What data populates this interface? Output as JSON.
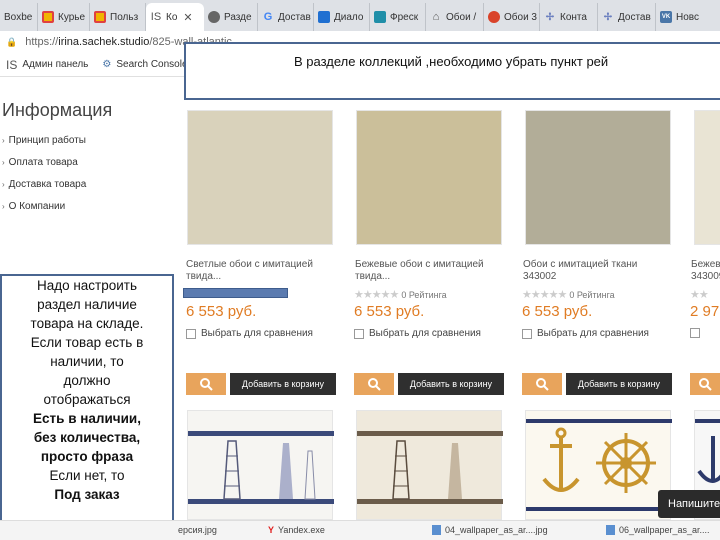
{
  "browser": {
    "tabs": [
      {
        "label": "Boxbe",
        "icon": "boxbe-icon",
        "color": "#ffffff",
        "text_color": "#444"
      },
      {
        "label": "Курье",
        "icon": "ms-icon",
        "color": "#e04040"
      },
      {
        "label": "Польз",
        "icon": "ms-icon",
        "color": "#e04040"
      },
      {
        "label": "Ко",
        "icon": "site-logo-icon",
        "color": "#ffffff",
        "active": true
      },
      {
        "label": "Разде",
        "icon": "wheel-icon",
        "color": "#666666"
      },
      {
        "label": "Достав",
        "icon": "google-icon",
        "color": "#4285f4"
      },
      {
        "label": "Диало",
        "icon": "chat-icon",
        "color": "#1f6fd1"
      },
      {
        "label": "Фреск",
        "icon": "fresco-icon",
        "color": "#1f8ea8"
      },
      {
        "label": "Обои /",
        "icon": "house-icon",
        "color": "#555555"
      },
      {
        "label": "Обои 3",
        "icon": "tomato-icon",
        "color": "#d9432a"
      },
      {
        "label": "Конта",
        "icon": "grid-icon",
        "color": "#6b7fbf"
      },
      {
        "label": "Достав",
        "icon": "grid-icon",
        "color": "#6b7fbf"
      },
      {
        "label": "Новс",
        "icon": "vk-icon",
        "color": "#4a76a8"
      }
    ],
    "url_prefix": "https://",
    "url_host": "irina.sachek.studio",
    "url_path": "/825-wall-atlantic",
    "bookmarks": {
      "admin": "Админ панель",
      "console": "Search Console"
    }
  },
  "sidebar": {
    "title": "Информация",
    "items": [
      "Принцип работы",
      "Оплата товара",
      "Доставка товара",
      "О Компании"
    ]
  },
  "products": [
    {
      "name_line1": "Светлые обои с имитацией",
      "name_line2": "твида...",
      "price": "6 553 руб.",
      "color": "#d9d2bb",
      "rating": null
    },
    {
      "name_line1": "Бежевые обои с имитацией",
      "name_line2": "твида...",
      "price": "6 553 руб.",
      "color": "#cbbf9a",
      "rating": "0 Рейтинга"
    },
    {
      "name_line1": "Обои с имитацией ткани",
      "name_line2": "343002",
      "price": "6 553 руб.",
      "color": "#b2ad98",
      "rating": "0 Рейтинга"
    },
    {
      "name_line1": "Бежевые",
      "name_line2": "343009",
      "price": "2 97",
      "color": "#e2dcc8",
      "rating": null
    }
  ],
  "product_common": {
    "compare_label": "Выбрать для сравнения",
    "cart_label": "Добавить в корзину"
  },
  "annotations": {
    "top": "В разделе коллекций ,необходимо убрать пункт рей",
    "left_lines": [
      {
        "text": "Надо настроить",
        "bold": false
      },
      {
        "text": "раздел наличие",
        "bold": false
      },
      {
        "text": "товара на складе.",
        "bold": false
      },
      {
        "text": "Если товар есть в",
        "bold": false
      },
      {
        "text": "наличии, то",
        "bold": false
      },
      {
        "text": "должно",
        "bold": false
      },
      {
        "text": "отображаться",
        "bold": false
      },
      {
        "text": "Есть в наличии,",
        "bold": true
      },
      {
        "text": "без количества,",
        "bold": true
      },
      {
        "text": "просто фраза",
        "bold": true
      },
      {
        "text": "Если нет, то",
        "bold": false
      },
      {
        "text": "Под заказ",
        "bold": true
      }
    ]
  },
  "chat_button": "Напишите",
  "downloads": [
    {
      "label": "ерсия.jpg",
      "icon": "file-icon"
    },
    {
      "label": "Yandex.exe",
      "icon": "yandex-icon"
    },
    {
      "label": "04_wallpaper_as_ar....jpg",
      "icon": "image-icon"
    },
    {
      "label": "06_wallpaper_as_ar....",
      "icon": "image-icon"
    }
  ]
}
